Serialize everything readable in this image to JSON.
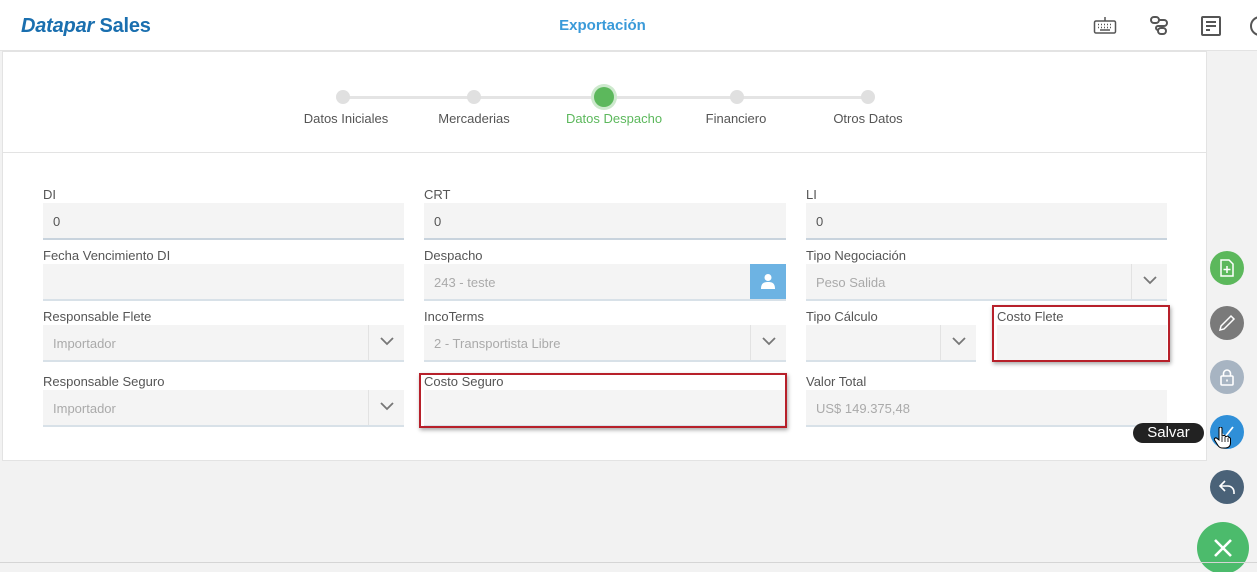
{
  "app": {
    "logo_left": "Datapar",
    "logo_right": "Sales",
    "title": "Exportación"
  },
  "top_icons": [
    "keyboard-icon",
    "route-icon",
    "cash-register-icon",
    "clock-icon"
  ],
  "stepper": {
    "steps": [
      {
        "label": "Datos Iniciales"
      },
      {
        "label": "Mercaderias"
      },
      {
        "label": "Datos Despacho"
      },
      {
        "label": "Financiero"
      },
      {
        "label": "Otros Datos"
      }
    ],
    "active_index": 2
  },
  "form": {
    "di": {
      "label": "DI",
      "value": "0"
    },
    "crt": {
      "label": "CRT",
      "value": "0"
    },
    "li": {
      "label": "LI",
      "value": "0"
    },
    "fecha_vencimiento_di": {
      "label": "Fecha Vencimiento DI",
      "value": ""
    },
    "despacho": {
      "label": "Despacho",
      "value": "243 - teste"
    },
    "tipo_negociacion": {
      "label": "Tipo Negociación",
      "value": "Peso Salida"
    },
    "responsable_flete": {
      "label": "Responsable Flete",
      "value": "Importador"
    },
    "incoterms": {
      "label": "IncoTerms",
      "value": "2 - Transportista Libre"
    },
    "tipo_calculo": {
      "label": "Tipo Cálculo",
      "value": ""
    },
    "costo_flete": {
      "label": "Costo Flete",
      "value": ""
    },
    "responsable_seguro": {
      "label": "Responsable Seguro",
      "value": "Importador"
    },
    "costo_seguro": {
      "label": "Costo Seguro",
      "value": ""
    },
    "valor_total": {
      "label": "Valor Total",
      "value": "US$ 149.375,48"
    }
  },
  "fab": {
    "tooltip": "Salvar",
    "colors": {
      "new": "#5cb85c",
      "edit": "#7a7a7a",
      "lock": "#a7b4c2",
      "save": "#2f8fd8",
      "back": "#4a6278",
      "close": "#4cbb6c"
    }
  }
}
